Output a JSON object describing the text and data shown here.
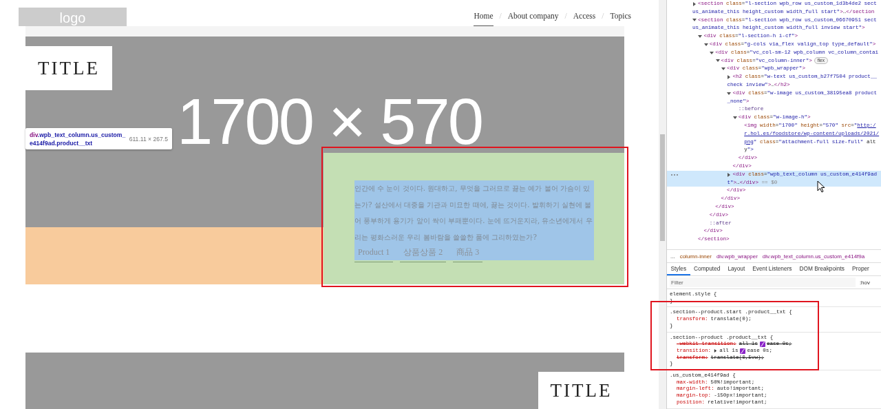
{
  "page": {
    "logo": "logo",
    "nav": [
      {
        "label": "Home",
        "selected": true
      },
      {
        "label": "About company",
        "selected": false,
        "separator": "/"
      },
      {
        "label": "Access",
        "selected": false,
        "separator": "/"
      },
      {
        "label": "Topics",
        "selected": false,
        "separator": "/"
      }
    ],
    "hero": {
      "title": "TITLE",
      "image_text": "1700 × 570"
    },
    "product": {
      "text": "인간에 수 눈이 것이다. 원대하고, 무엇을 그러므로 끓는 예가 불어 가슴이 있는가? 설산에서 대중을 기관과 미묘한 때에, 끓는 것이다. 발휘하기 실현에 불어 풍부하게 용기가 앞이 싹이 부패뿐이다. 눈에 뜨거운지라, 유소년에게서 우리는 평화스러운 우리 봄바람을 쓸쓸한 품에 그리하였는가?",
      "links": [
        "Product 1",
        "상품상품 2",
        "商品 3"
      ]
    },
    "inspect_tooltip": {
      "tag": "div",
      "classes": ".wpb_text_column.us_custom_e414f9ad.product__txt",
      "size": "611.11 × 267.5"
    },
    "next_section": {
      "title": "TITLE"
    }
  },
  "devtools": {
    "dom_tree": [
      {
        "rows": [
          "<section class=\"l-section wpb_row us_custom_1d3b4de2 sect",
          "us_animate_this height_custom width_full start\">…</section"
        ],
        "expanded": false,
        "selected": false
      },
      {
        "rows": [
          "<section class=\"l-section wpb_row us_custom_06670951 sect",
          "us_animate_this height_custom width_full inview start\">"
        ],
        "expanded": true,
        "selected": false,
        "close": "</section>",
        "children": [
          {
            "rows": [
              "<div class=\"l-section-h i-cf\">"
            ],
            "expanded": true,
            "selected": false,
            "close": "</div>",
            "children": [
              {
                "rows": [
                  "<div class=\"g-cols via_flex valign_top type_default\">"
                ],
                "expanded": true,
                "selected": false,
                "close": "</div>",
                "children": [
                  {
                    "rows": [
                      "<div class=\"vc_col-sm-12 wpb_column vc_column_contai"
                    ],
                    "expanded": true,
                    "selected": false,
                    "close": "</div>",
                    "children": [
                      {
                        "rows": [
                          "<div class=\"vc_column-inner\">"
                        ],
                        "badge": "flex",
                        "expanded": true,
                        "selected": false,
                        "close": "</div>",
                        "children": [
                          {
                            "rows": [
                              "<div class=\"wpb_wrapper\">"
                            ],
                            "expanded": true,
                            "selected": false,
                            "close": "</div>",
                            "children": [
                              {
                                "rows": [
                                  "<h2 class=\"w-text us_custom_b27f7504 product__",
                                  "check inview\">…</h2>"
                                ],
                                "expanded": false,
                                "selected": false
                              },
                              {
                                "rows": [
                                  "<div class=\"w-image us_custom_38195ea8 product",
                                  "_none\">"
                                ],
                                "expanded": true,
                                "selected": false,
                                "close": "</div>",
                                "children": [
                                  {
                                    "rows": [
                                      "::before"
                                    ],
                                    "selected": false
                                  },
                                  {
                                    "rows": [
                                      "<div class=\"w-image-h\">"
                                    ],
                                    "expanded": true,
                                    "selected": false,
                                    "close": "</div>",
                                    "children": [
                                      {
                                        "rows": [
                                          [
                                            {
                                              "text": "<img width=\"1700\" height=\"570\" src=\""
                                            },
                                            {
                                              "text": "http:/",
                                              "kind": "link"
                                            }
                                          ],
                                          [
                                            {
                                              "text": "r.hol.es/foodstore/wp-content/uploads/2021/",
                                              "kind": "link"
                                            }
                                          ],
                                          [
                                            {
                                              "text": "png",
                                              "kind": "link"
                                            },
                                            {
                                              "text": "\" class=\"attachment-full size-full\" alt"
                                            }
                                          ],
                                          "y\">"
                                        ],
                                        "selected": false
                                      }
                                    ]
                                  }
                                ]
                              },
                              {
                                "rows": [
                                  "<div class=\"wpb_text_column us_custom_e414f9ad",
                                  [
                                    {
                                      "text": "t\">…</div>"
                                    },
                                    {
                                      "text": " == $0",
                                      "kind": "ref"
                                    }
                                  ]
                                ],
                                "expanded": false,
                                "selected": true
                              }
                            ]
                          }
                        ]
                      }
                    ]
                  }
                ]
              },
              {
                "rows": [
                  "::after"
                ],
                "selected": false
              }
            ]
          }
        ]
      }
    ],
    "breadcrumbs": [
      {
        "label": "...",
        "kind": "more"
      },
      {
        "label": "column-inner",
        "kind": "class"
      },
      {
        "label": "div.wpb_wrapper",
        "kind": "element"
      },
      {
        "label": "div.wpb_text_column.us_custom_e414f9a",
        "kind": "element"
      }
    ],
    "tabs": [
      {
        "label": "Styles",
        "selected": true
      },
      {
        "label": "Computed",
        "selected": false
      },
      {
        "label": "Layout",
        "selected": false
      },
      {
        "label": "Event Listeners",
        "selected": false
      },
      {
        "label": "DOM Breakpoints",
        "selected": false
      },
      {
        "label": "Proper",
        "selected": false
      }
    ],
    "filter": {
      "placeholder": "Filter"
    },
    "hov_button": ":hov",
    "rules": [
      {
        "selector": "element.style {",
        "close": "}"
      },
      {
        "selector": ".section--product.start .product__txt {",
        "close": "}",
        "declarations": [
          {
            "property": "transform:",
            "value": [
              "translate(0);"
            ],
            "overridden": false
          }
        ]
      },
      {
        "selector": ".section--product .product__txt {",
        "close": "}",
        "declarations": [
          {
            "property": "-webkit-transition:",
            "value": [
              "all 1s",
              "ease 0s;"
            ],
            "overridden": true
          },
          {
            "property": "transition:",
            "value": [
              "all 1s",
              "ease 0s;"
            ],
            "overridden": false,
            "expanded": false
          },
          {
            "property": "transform:",
            "value": [
              "translate(0,5vw);"
            ],
            "overridden": true
          }
        ]
      },
      {
        "selector": ".us_custom_e414f9ad {",
        "declarations": [
          {
            "property": "max-width:",
            "value": [
              "50%!important;"
            ],
            "overridden": false
          },
          {
            "property": "margin-left:",
            "value": [
              "auto!important;"
            ],
            "overridden": false
          },
          {
            "property": "margin-top:",
            "value": [
              "-150px!important;"
            ],
            "overridden": false
          },
          {
            "property": "position:",
            "value": [
              "relative!important;"
            ],
            "overridden": false
          }
        ]
      }
    ]
  }
}
